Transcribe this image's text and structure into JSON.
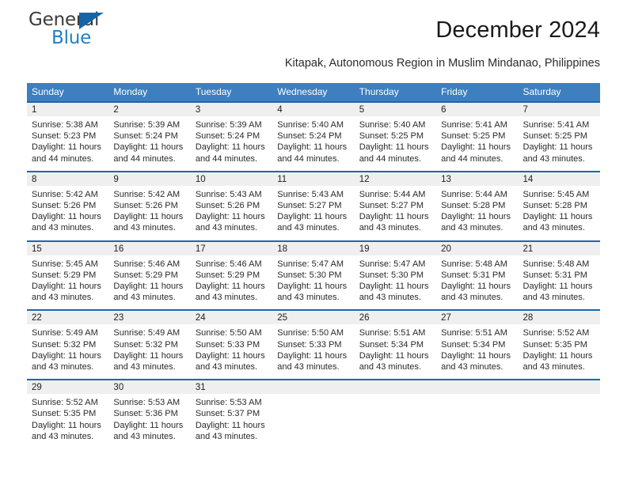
{
  "brand": {
    "general_text": "General",
    "blue_text": "Blue",
    "triangle_color": "#1565a8",
    "blue_color": "#1f7fc4"
  },
  "header": {
    "title": "December 2024",
    "subtitle": "Kitapak, Autonomous Region in Muslim Mindanao, Philippines"
  },
  "theme": {
    "header_bg": "#3d7fbf",
    "row_divider": "#1f66ab",
    "day_band_bg": "#efefef"
  },
  "calendar": {
    "weekdays": [
      "Sunday",
      "Monday",
      "Tuesday",
      "Wednesday",
      "Thursday",
      "Friday",
      "Saturday"
    ],
    "weeks": [
      [
        {
          "day": "1",
          "sunrise": "Sunrise: 5:38 AM",
          "sunset": "Sunset: 5:23 PM",
          "daylight1": "Daylight: 11 hours",
          "daylight2": "and 44 minutes."
        },
        {
          "day": "2",
          "sunrise": "Sunrise: 5:39 AM",
          "sunset": "Sunset: 5:24 PM",
          "daylight1": "Daylight: 11 hours",
          "daylight2": "and 44 minutes."
        },
        {
          "day": "3",
          "sunrise": "Sunrise: 5:39 AM",
          "sunset": "Sunset: 5:24 PM",
          "daylight1": "Daylight: 11 hours",
          "daylight2": "and 44 minutes."
        },
        {
          "day": "4",
          "sunrise": "Sunrise: 5:40 AM",
          "sunset": "Sunset: 5:24 PM",
          "daylight1": "Daylight: 11 hours",
          "daylight2": "and 44 minutes."
        },
        {
          "day": "5",
          "sunrise": "Sunrise: 5:40 AM",
          "sunset": "Sunset: 5:25 PM",
          "daylight1": "Daylight: 11 hours",
          "daylight2": "and 44 minutes."
        },
        {
          "day": "6",
          "sunrise": "Sunrise: 5:41 AM",
          "sunset": "Sunset: 5:25 PM",
          "daylight1": "Daylight: 11 hours",
          "daylight2": "and 44 minutes."
        },
        {
          "day": "7",
          "sunrise": "Sunrise: 5:41 AM",
          "sunset": "Sunset: 5:25 PM",
          "daylight1": "Daylight: 11 hours",
          "daylight2": "and 43 minutes."
        }
      ],
      [
        {
          "day": "8",
          "sunrise": "Sunrise: 5:42 AM",
          "sunset": "Sunset: 5:26 PM",
          "daylight1": "Daylight: 11 hours",
          "daylight2": "and 43 minutes."
        },
        {
          "day": "9",
          "sunrise": "Sunrise: 5:42 AM",
          "sunset": "Sunset: 5:26 PM",
          "daylight1": "Daylight: 11 hours",
          "daylight2": "and 43 minutes."
        },
        {
          "day": "10",
          "sunrise": "Sunrise: 5:43 AM",
          "sunset": "Sunset: 5:26 PM",
          "daylight1": "Daylight: 11 hours",
          "daylight2": "and 43 minutes."
        },
        {
          "day": "11",
          "sunrise": "Sunrise: 5:43 AM",
          "sunset": "Sunset: 5:27 PM",
          "daylight1": "Daylight: 11 hours",
          "daylight2": "and 43 minutes."
        },
        {
          "day": "12",
          "sunrise": "Sunrise: 5:44 AM",
          "sunset": "Sunset: 5:27 PM",
          "daylight1": "Daylight: 11 hours",
          "daylight2": "and 43 minutes."
        },
        {
          "day": "13",
          "sunrise": "Sunrise: 5:44 AM",
          "sunset": "Sunset: 5:28 PM",
          "daylight1": "Daylight: 11 hours",
          "daylight2": "and 43 minutes."
        },
        {
          "day": "14",
          "sunrise": "Sunrise: 5:45 AM",
          "sunset": "Sunset: 5:28 PM",
          "daylight1": "Daylight: 11 hours",
          "daylight2": "and 43 minutes."
        }
      ],
      [
        {
          "day": "15",
          "sunrise": "Sunrise: 5:45 AM",
          "sunset": "Sunset: 5:29 PM",
          "daylight1": "Daylight: 11 hours",
          "daylight2": "and 43 minutes."
        },
        {
          "day": "16",
          "sunrise": "Sunrise: 5:46 AM",
          "sunset": "Sunset: 5:29 PM",
          "daylight1": "Daylight: 11 hours",
          "daylight2": "and 43 minutes."
        },
        {
          "day": "17",
          "sunrise": "Sunrise: 5:46 AM",
          "sunset": "Sunset: 5:29 PM",
          "daylight1": "Daylight: 11 hours",
          "daylight2": "and 43 minutes."
        },
        {
          "day": "18",
          "sunrise": "Sunrise: 5:47 AM",
          "sunset": "Sunset: 5:30 PM",
          "daylight1": "Daylight: 11 hours",
          "daylight2": "and 43 minutes."
        },
        {
          "day": "19",
          "sunrise": "Sunrise: 5:47 AM",
          "sunset": "Sunset: 5:30 PM",
          "daylight1": "Daylight: 11 hours",
          "daylight2": "and 43 minutes."
        },
        {
          "day": "20",
          "sunrise": "Sunrise: 5:48 AM",
          "sunset": "Sunset: 5:31 PM",
          "daylight1": "Daylight: 11 hours",
          "daylight2": "and 43 minutes."
        },
        {
          "day": "21",
          "sunrise": "Sunrise: 5:48 AM",
          "sunset": "Sunset: 5:31 PM",
          "daylight1": "Daylight: 11 hours",
          "daylight2": "and 43 minutes."
        }
      ],
      [
        {
          "day": "22",
          "sunrise": "Sunrise: 5:49 AM",
          "sunset": "Sunset: 5:32 PM",
          "daylight1": "Daylight: 11 hours",
          "daylight2": "and 43 minutes."
        },
        {
          "day": "23",
          "sunrise": "Sunrise: 5:49 AM",
          "sunset": "Sunset: 5:32 PM",
          "daylight1": "Daylight: 11 hours",
          "daylight2": "and 43 minutes."
        },
        {
          "day": "24",
          "sunrise": "Sunrise: 5:50 AM",
          "sunset": "Sunset: 5:33 PM",
          "daylight1": "Daylight: 11 hours",
          "daylight2": "and 43 minutes."
        },
        {
          "day": "25",
          "sunrise": "Sunrise: 5:50 AM",
          "sunset": "Sunset: 5:33 PM",
          "daylight1": "Daylight: 11 hours",
          "daylight2": "and 43 minutes."
        },
        {
          "day": "26",
          "sunrise": "Sunrise: 5:51 AM",
          "sunset": "Sunset: 5:34 PM",
          "daylight1": "Daylight: 11 hours",
          "daylight2": "and 43 minutes."
        },
        {
          "day": "27",
          "sunrise": "Sunrise: 5:51 AM",
          "sunset": "Sunset: 5:34 PM",
          "daylight1": "Daylight: 11 hours",
          "daylight2": "and 43 minutes."
        },
        {
          "day": "28",
          "sunrise": "Sunrise: 5:52 AM",
          "sunset": "Sunset: 5:35 PM",
          "daylight1": "Daylight: 11 hours",
          "daylight2": "and 43 minutes."
        }
      ],
      [
        {
          "day": "29",
          "sunrise": "Sunrise: 5:52 AM",
          "sunset": "Sunset: 5:35 PM",
          "daylight1": "Daylight: 11 hours",
          "daylight2": "and 43 minutes."
        },
        {
          "day": "30",
          "sunrise": "Sunrise: 5:53 AM",
          "sunset": "Sunset: 5:36 PM",
          "daylight1": "Daylight: 11 hours",
          "daylight2": "and 43 minutes."
        },
        {
          "day": "31",
          "sunrise": "Sunrise: 5:53 AM",
          "sunset": "Sunset: 5:37 PM",
          "daylight1": "Daylight: 11 hours",
          "daylight2": "and 43 minutes."
        },
        {
          "day": "",
          "sunrise": "",
          "sunset": "",
          "daylight1": "",
          "daylight2": ""
        },
        {
          "day": "",
          "sunrise": "",
          "sunset": "",
          "daylight1": "",
          "daylight2": ""
        },
        {
          "day": "",
          "sunrise": "",
          "sunset": "",
          "daylight1": "",
          "daylight2": ""
        },
        {
          "day": "",
          "sunrise": "",
          "sunset": "",
          "daylight1": "",
          "daylight2": ""
        }
      ]
    ]
  }
}
